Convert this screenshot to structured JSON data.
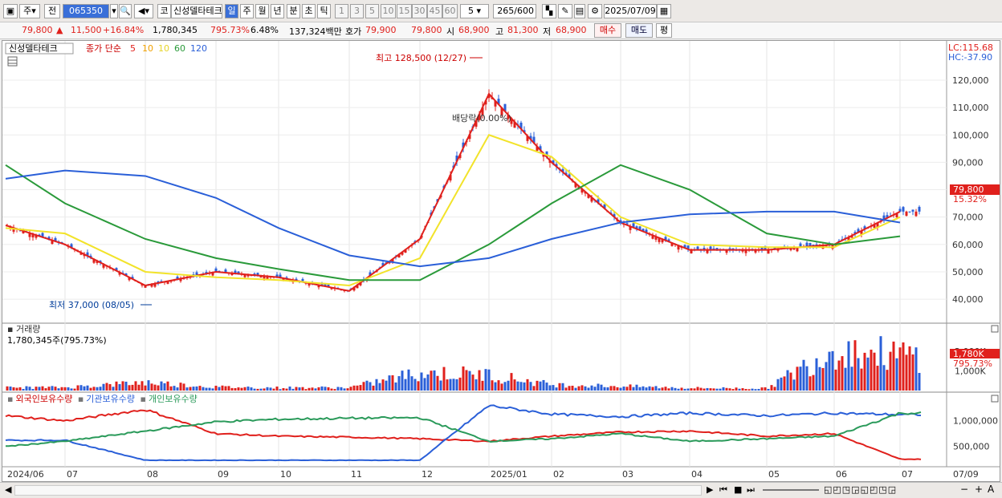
{
  "toolbar": {
    "period_type": "주",
    "prev_label": "전",
    "code": "065350",
    "code_prefix": "코",
    "stock_name": "신성델타테크",
    "tabs": [
      "일",
      "주",
      "월",
      "년",
      "분",
      "초",
      "틱"
    ],
    "selected_tab": "일",
    "intervals": [
      "1",
      "3",
      "5",
      "10",
      "15",
      "30",
      "45",
      "60"
    ],
    "interval_value": "5",
    "count": "265",
    "count_max": "/600",
    "date": "2025/07/09"
  },
  "info": {
    "price": "79,800",
    "change": "11,500",
    "change_pct": "+16.84%",
    "volume": "1,780,345",
    "volume_pct": "795.73%",
    "turnover": "6.48%",
    "trade_value": "137,324백만",
    "quote_label": "호가",
    "ask": "79,900",
    "bid": "79,800",
    "open_label": "시",
    "open": "68,900",
    "high_label": "고",
    "high": "81,300",
    "low_label": "저",
    "low": "68,900",
    "buy_label": "매수",
    "sell_label": "매도",
    "avg_label": "평"
  },
  "price_panel": {
    "legend_name": "신성델타테크",
    "legend_ma_label": "종가 단순",
    "ma_periods": [
      "5",
      "10",
      "20",
      "60",
      "120"
    ],
    "ma_colors": [
      "#e0201c",
      "#f0a000",
      "#f2e32a",
      "#2a9a3a",
      "#2a5fd8"
    ],
    "lc": "LC:115.68",
    "hc": "HC:-37.90",
    "high_note": "최고 128,500 (12/27)",
    "low_note": "최저 37,000 (08/05)",
    "dividend_note": "배당락(0.00%)",
    "y_ticks": [
      "120,000",
      "110,000",
      "100,000",
      "90,000",
      "80,000",
      "70,000",
      "60,000",
      "50,000",
      "40,000"
    ],
    "current_price_tag": "79,800",
    "current_pct_tag": "15.32%"
  },
  "volume_panel": {
    "title": "거래량",
    "value": "1,780,345주(795.73%)",
    "y_ticks": [
      "2,000K",
      "1,000K"
    ],
    "current_tag": "1,780K",
    "current_pct": "795.73%"
  },
  "holder_panel": {
    "legends": [
      "외국인보유수량",
      "기관보유수량",
      "개인보유수량"
    ],
    "colors": [
      "#e0201c",
      "#2a5fd8",
      "#2a9a5a"
    ],
    "y_ticks": [
      "1,000,000",
      "500,000"
    ]
  },
  "x_axis": [
    "2024/06",
    "07",
    "08",
    "09",
    "10",
    "11",
    "12",
    "2025/01",
    "02",
    "03",
    "04",
    "05",
    "06",
    "07"
  ],
  "x_axis_end": "07/09",
  "chart_data": [
    {
      "type": "line",
      "title": "",
      "ylabel": "",
      "ylim": [
        33000,
        132000
      ],
      "x": [
        "2024/06",
        "07",
        "08",
        "09",
        "10",
        "11",
        "12",
        "2025/01",
        "02",
        "03",
        "04",
        "05",
        "06",
        "07"
      ],
      "series": [
        {
          "name": "5",
          "values": [
            67000,
            60000,
            45000,
            50000,
            48000,
            43000,
            62000,
            115000,
            90000,
            68000,
            58000,
            58000,
            60000,
            72000
          ]
        },
        {
          "name": "20",
          "values": [
            66000,
            64000,
            50000,
            48000,
            47000,
            45000,
            55000,
            100000,
            92000,
            70000,
            60000,
            59000,
            59000,
            70000
          ]
        },
        {
          "name": "60",
          "values": [
            89000,
            75000,
            62000,
            55000,
            51000,
            47000,
            47000,
            60000,
            75000,
            89000,
            80000,
            64000,
            60000,
            63000
          ]
        },
        {
          "name": "120",
          "values": [
            84000,
            87000,
            85000,
            77000,
            66000,
            56000,
            52000,
            55000,
            62000,
            68000,
            71000,
            72000,
            72000,
            68000
          ]
        }
      ],
      "annotations": {
        "high": 128500,
        "low": 37000,
        "last": 79800
      }
    },
    {
      "type": "bar",
      "title": "",
      "x": [
        "2024/06",
        "07",
        "08",
        "09",
        "10",
        "11",
        "12",
        "2025/01",
        "02",
        "03",
        "04",
        "05",
        "06",
        "07"
      ],
      "values": [
        150,
        160,
        420,
        180,
        140,
        150,
        900,
        800,
        300,
        220,
        130,
        110,
        2100,
        1780
      ],
      "ylim": [
        0,
        2600
      ]
    },
    {
      "type": "line",
      "title": "",
      "ylim": [
        150000,
        1450000
      ],
      "x": [
        "2024/06",
        "07",
        "08",
        "09",
        "10",
        "11",
        "12",
        "2025/01",
        "02",
        "03",
        "04",
        "05",
        "06",
        "07"
      ],
      "series": [
        {
          "name": "외국인보유수량",
          "values": [
            1100000,
            1000000,
            1220000,
            750000,
            700000,
            680000,
            650000,
            600000,
            700000,
            780000,
            800000,
            700000,
            750000,
            250000
          ]
        },
        {
          "name": "기관보유수량",
          "values": [
            620000,
            620000,
            230000,
            230000,
            230000,
            230000,
            230000,
            1300000,
            1130000,
            1080000,
            1150000,
            1100000,
            1150000,
            1120000
          ]
        },
        {
          "name": "개인보유수량",
          "values": [
            500000,
            600000,
            800000,
            980000,
            1030000,
            1050000,
            1060000,
            600000,
            650000,
            750000,
            600000,
            650000,
            700000,
            1150000
          ]
        }
      ]
    }
  ]
}
